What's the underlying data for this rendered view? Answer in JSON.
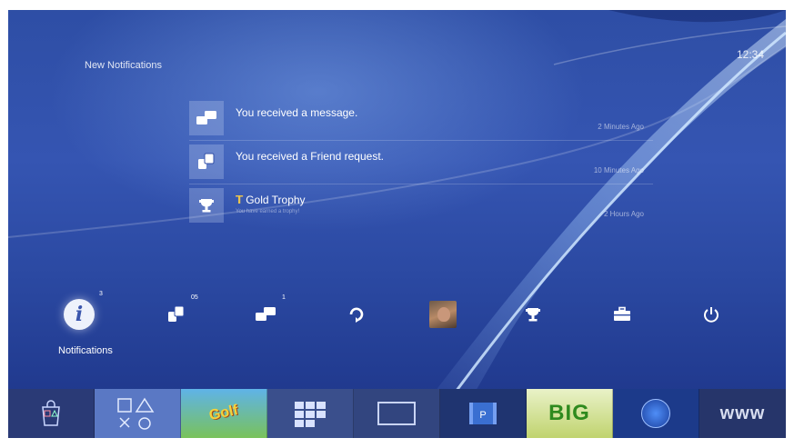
{
  "header": {
    "title": "New Notifications",
    "clock": "12:34"
  },
  "notifications": [
    {
      "icon": "message-icon",
      "text": "You received a message.",
      "subtitle": "",
      "time": "2 Minutes Ago"
    },
    {
      "icon": "friends-icon",
      "text": "You received a Friend request.",
      "subtitle": "",
      "time": "10 Minutes Ago"
    },
    {
      "icon": "trophy-icon",
      "text": "Gold Trophy",
      "subtitle": "You have earned a trophy!",
      "time": "2 Hours Ago"
    }
  ],
  "function_bar": {
    "selected_label": "Notifications",
    "items": [
      {
        "name": "notifications-icon",
        "badge": "3"
      },
      {
        "name": "friends-icon",
        "badge": "05"
      },
      {
        "name": "messages-icon",
        "badge": "1"
      },
      {
        "name": "party-icon",
        "badge": ""
      },
      {
        "name": "profile-avatar",
        "badge": ""
      },
      {
        "name": "trophy-icon",
        "badge": ""
      },
      {
        "name": "settings-toolbox-icon",
        "badge": ""
      },
      {
        "name": "power-icon",
        "badge": ""
      }
    ]
  },
  "content_bar": {
    "tiles": [
      {
        "name": "playstation-store-tile",
        "label": ""
      },
      {
        "name": "ps-buttons-tile",
        "label": ""
      },
      {
        "name": "everybodys-golf-tile",
        "label": "Golf"
      },
      {
        "name": "library-tile",
        "label": ""
      },
      {
        "name": "tv-video-tile",
        "label": ""
      },
      {
        "name": "video-unlimited-tile",
        "label": ""
      },
      {
        "name": "big-game-tile",
        "label": "BIG"
      },
      {
        "name": "playstation-plus-tile",
        "label": ""
      },
      {
        "name": "internet-browser-tile",
        "label": "www"
      }
    ]
  },
  "colors": {
    "background": "#2e4ea5",
    "content_bar": "#1d2c5a",
    "trophy_gold": "#e8c350"
  }
}
